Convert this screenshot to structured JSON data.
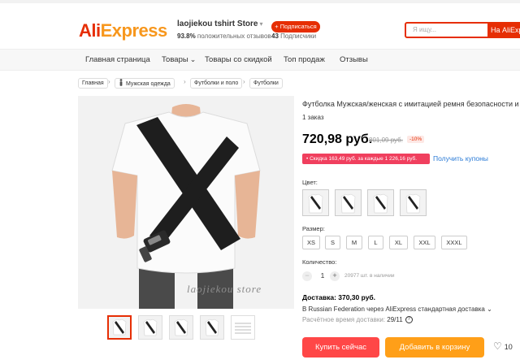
{
  "header": {
    "logo_part1": "Ali",
    "logo_part2": "Express",
    "store_name": "laojiekou tshirt Store",
    "store_caret": "▾",
    "positive_pct": "93.8%",
    "positive_label": "положительных отзывов",
    "follow_label": "+ Подписаться",
    "followers_count": "43",
    "followers_label": "Подписчики",
    "search_placeholder": "Я ищу...",
    "search_button": "На AliExpre"
  },
  "nav": {
    "items": [
      "Главная страница",
      "Товары",
      "Товары со скидкой",
      "Топ продаж",
      "Отзывы"
    ],
    "dropdown_arrow": "⌄"
  },
  "breadcrumb": {
    "items": [
      "Главная",
      "Мужская одежда",
      "Футболки и поло",
      "Футболки"
    ],
    "separator": "›"
  },
  "product": {
    "title": "Футболка Мужская/женская с имитацией ремня безопасности и принтом",
    "orders": "1 заказ",
    "price": "720,98 руб.",
    "old_price": "801,09 руб.",
    "discount": "-10%",
    "coupon_text": "• Скидка 163,49 руб. за каждые 1 226,16 руб.",
    "coupon_link": "Получить купоны",
    "watermark": "laojiekou store"
  },
  "options": {
    "color_label": "Цвет:",
    "size_label": "Размер:",
    "sizes": [
      "XS",
      "S",
      "M",
      "L",
      "XL",
      "XXL",
      "XXXL"
    ],
    "quantity_label": "Количество:",
    "qty_minus": "−",
    "quantity": "1",
    "qty_plus": "+",
    "stock": "20977 шт. в наличии"
  },
  "shipping": {
    "price": "Доставка: 370,30 руб.",
    "method": "В Russian Federation через AliExpress стандартная доставка",
    "method_arrow": "⌄",
    "time_label": "Расчётное время доставки:",
    "time_value": "29/11",
    "info_glyph": "?"
  },
  "actions": {
    "buy_now": "Купить сейчас",
    "add_to_cart": "Добавить в корзину",
    "wish_icon": "♡",
    "wish_count": "10"
  },
  "colors": {
    "accent": "#e62e04",
    "buy": "#ff4747",
    "cart": "#ff9f18",
    "coupon": "#f03f5e",
    "link": "#2b7bd6"
  }
}
